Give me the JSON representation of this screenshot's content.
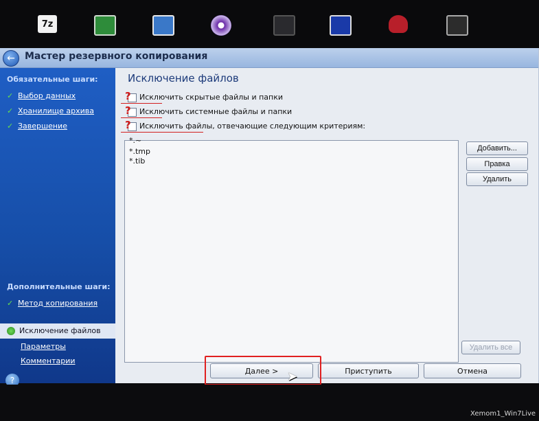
{
  "taskbar": {
    "icons": [
      "7zip-icon",
      "notepad-icon",
      "editor-icon",
      "disc-icon",
      "box-icon",
      "shield-icon",
      "red-app-icon",
      "ssd-icon"
    ],
    "sevenzip_label": "7z"
  },
  "window": {
    "title": "Мастер резервного копирования"
  },
  "sidebar": {
    "required_heading": "Обязательные шаги:",
    "required_items": [
      "Выбор данных",
      "Хранилище архива",
      "Завершение"
    ],
    "optional_heading": "Дополнительные шаги:",
    "optional_items": [
      "Метод копирования",
      "Исключение файлов",
      "Параметры",
      "Комментарии"
    ]
  },
  "content": {
    "title": "Исключение файлов",
    "checkbox_hidden": "Исключить скрытые файлы и папки",
    "checkbox_system": "Исключить системные файлы и папки",
    "checkbox_criteria": "Исключить файлы, отвечающие следующим критериям:",
    "criteria": [
      "*.~",
      "*.tmp",
      "*.tib"
    ],
    "btn_add": "Добавить...",
    "btn_edit": "Правка",
    "btn_delete": "Удалить",
    "btn_delete_all": "Удалить все"
  },
  "footer": {
    "btn_next": "Далее >",
    "btn_proceed": "Приступить",
    "btn_cancel": "Отмена"
  },
  "annotation": {
    "mark": "?",
    "color": "#d21e1e"
  },
  "watermark": "Xemom1_Win7Live"
}
